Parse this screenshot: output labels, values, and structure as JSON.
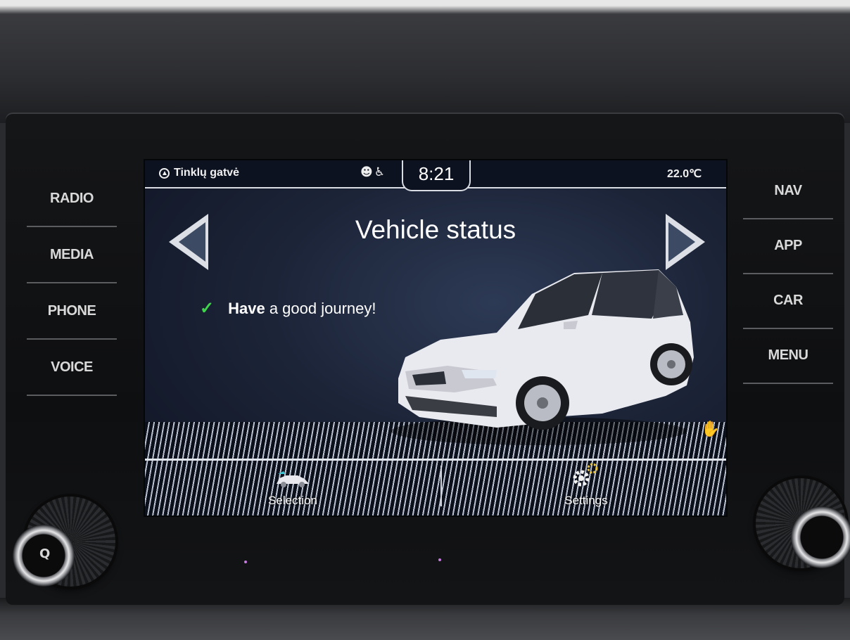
{
  "hardware": {
    "left_buttons": [
      "RADIO",
      "MEDIA",
      "PHONE",
      "VOICE"
    ],
    "right_buttons": [
      "NAV",
      "APP",
      "CAR",
      "MENU"
    ],
    "left_knob_glyph": "Q"
  },
  "status_bar": {
    "location": "Tinklų gatvė",
    "time": "8:21",
    "temperature": "22.0℃"
  },
  "main": {
    "title": "Vehicle status",
    "message_bold": "Have",
    "message_rest": " a good journey!"
  },
  "bottom_bar": {
    "left_label": "Selection",
    "right_label": "Settings"
  },
  "colors": {
    "check": "#3fd64b",
    "screen_bg": "#1c2438",
    "car_body": "#e9e9f0"
  },
  "icons": [
    "location-icon",
    "driver-icon",
    "check-icon",
    "left-arrow-icon",
    "right-arrow-icon",
    "car-selection-icon",
    "settings-gear-icon",
    "hand-gesture-icon"
  ]
}
